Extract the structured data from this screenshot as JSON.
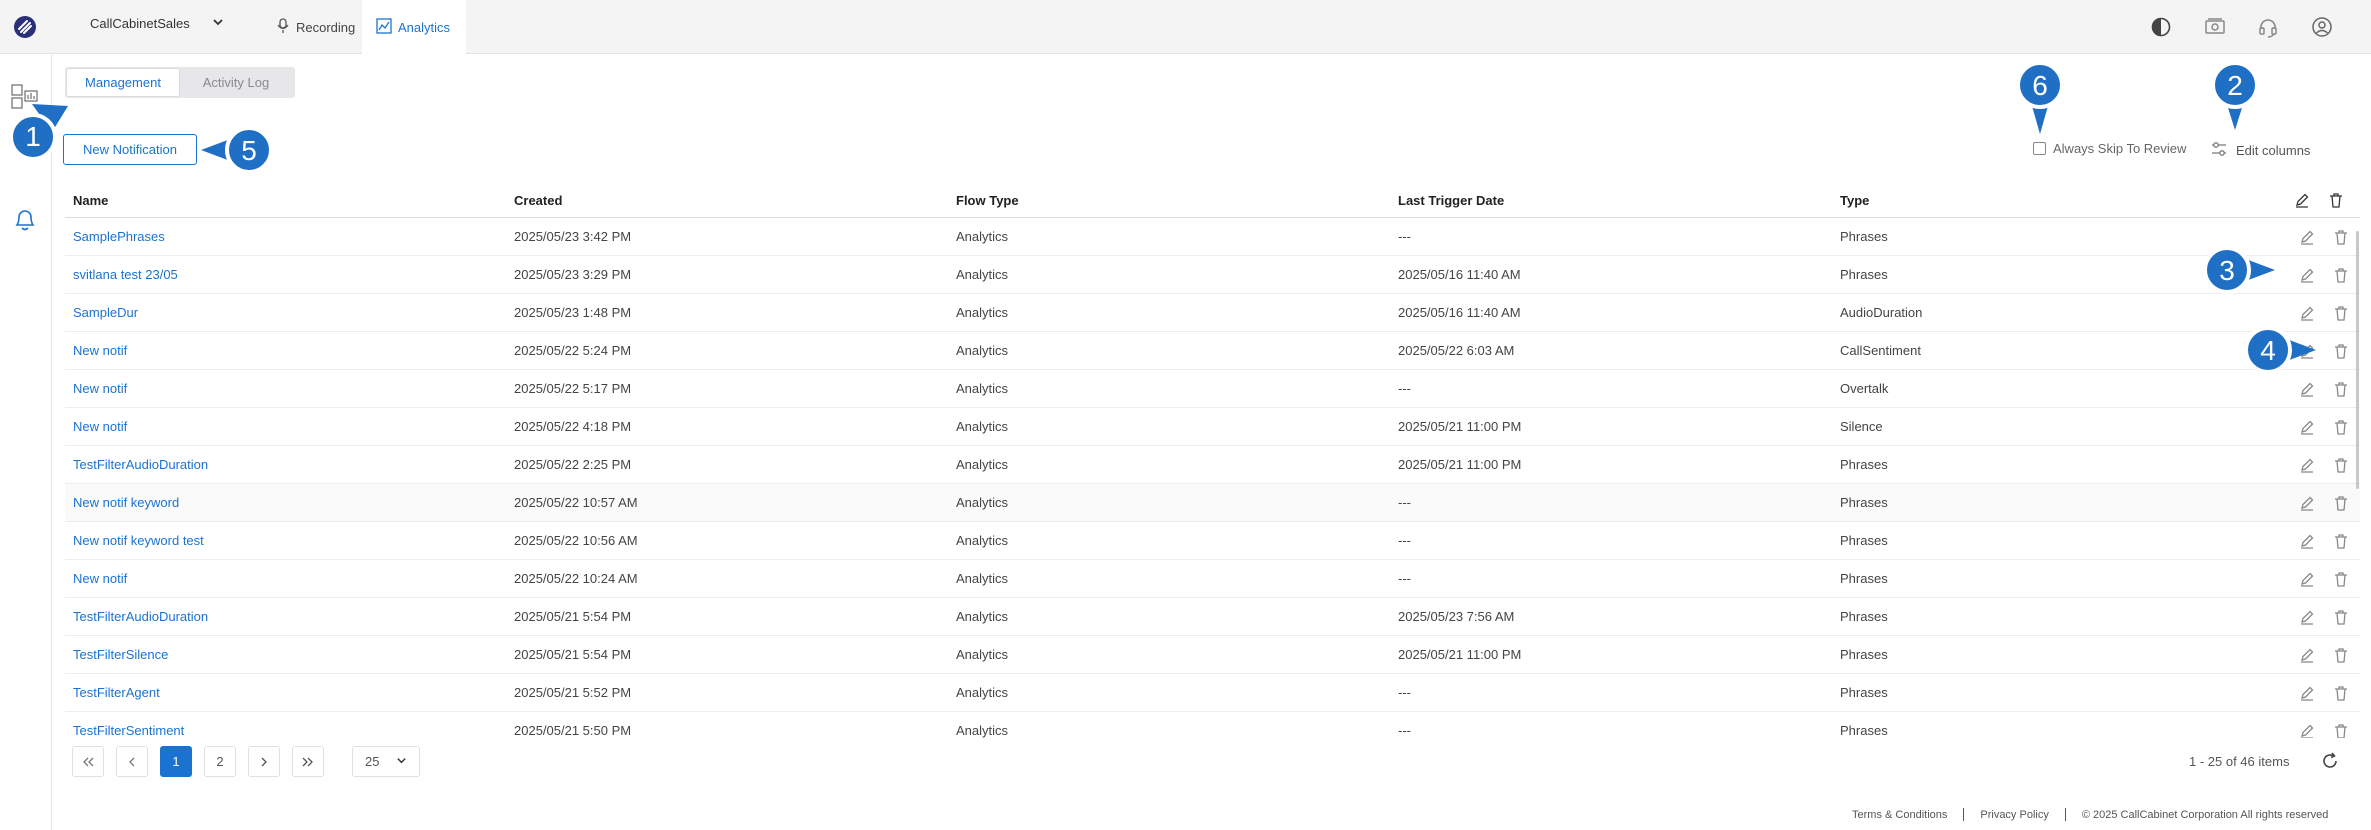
{
  "header": {
    "workspace": "CallCabinetSales",
    "nav": [
      {
        "label": "Recording",
        "icon": "microphone-icon"
      },
      {
        "label": "Analytics",
        "icon": "chart-icon",
        "active": true
      }
    ],
    "right_icons": [
      "contrast-icon",
      "cash-icon",
      "headset-icon",
      "user-icon"
    ]
  },
  "sidebar": {
    "items": [
      {
        "icon": "dashboard-icon"
      },
      {
        "icon": "bell-icon",
        "active": true
      }
    ]
  },
  "tabs": [
    {
      "label": "Management",
      "active": true
    },
    {
      "label": "Activity Log",
      "active": false
    }
  ],
  "toolbar": {
    "new_label": "New Notification",
    "skip_label": "Always Skip To Review",
    "edit_columns_label": "Edit columns"
  },
  "table": {
    "columns": [
      "Name",
      "Created",
      "Flow Type",
      "Last Trigger Date",
      "Type"
    ],
    "rows": [
      {
        "name": "SamplePhrases",
        "created": "2025/05/23 3:42 PM",
        "flow": "Analytics",
        "last": "---",
        "type": "Phrases"
      },
      {
        "name": "svitlana test 23/05",
        "created": "2025/05/23 3:29 PM",
        "flow": "Analytics",
        "last": "2025/05/16 11:40 AM",
        "type": "Phrases"
      },
      {
        "name": "SampleDur",
        "created": "2025/05/23 1:48 PM",
        "flow": "Analytics",
        "last": "2025/05/16 11:40 AM",
        "type": "AudioDuration"
      },
      {
        "name": "New notif",
        "created": "2025/05/22 5:24 PM",
        "flow": "Analytics",
        "last": "2025/05/22 6:03 AM",
        "type": "CallSentiment"
      },
      {
        "name": "New notif",
        "created": "2025/05/22 5:17 PM",
        "flow": "Analytics",
        "last": "---",
        "type": "Overtalk"
      },
      {
        "name": "New notif",
        "created": "2025/05/22 4:18 PM",
        "flow": "Analytics",
        "last": "2025/05/21 11:00 PM",
        "type": "Silence"
      },
      {
        "name": "TestFilterAudioDuration",
        "created": "2025/05/22 2:25 PM",
        "flow": "Analytics",
        "last": "2025/05/21 11:00 PM",
        "type": "Phrases"
      },
      {
        "name": "New notif keyword",
        "created": "2025/05/22 10:57 AM",
        "flow": "Analytics",
        "last": "---",
        "type": "Phrases"
      },
      {
        "name": "New notif keyword test",
        "created": "2025/05/22 10:56 AM",
        "flow": "Analytics",
        "last": "---",
        "type": "Phrases"
      },
      {
        "name": "New notif",
        "created": "2025/05/22 10:24 AM",
        "flow": "Analytics",
        "last": "---",
        "type": "Phrases"
      },
      {
        "name": "TestFilterAudioDuration",
        "created": "2025/05/21 5:54 PM",
        "flow": "Analytics",
        "last": "2025/05/23 7:56 AM",
        "type": "Phrases"
      },
      {
        "name": "TestFilterSilence",
        "created": "2025/05/21 5:54 PM",
        "flow": "Analytics",
        "last": "2025/05/21 11:00 PM",
        "type": "Phrases"
      },
      {
        "name": "TestFilterAgent",
        "created": "2025/05/21 5:52 PM",
        "flow": "Analytics",
        "last": "---",
        "type": "Phrases"
      },
      {
        "name": "TestFilterSentiment",
        "created": "2025/05/21 5:50 PM",
        "flow": "Analytics",
        "last": "---",
        "type": "Phrases"
      }
    ]
  },
  "pagination": {
    "pages": [
      "1",
      "2"
    ],
    "current": "1",
    "page_size": "25",
    "info": "1 - 25 of 46 items"
  },
  "footer": {
    "terms": "Terms & Conditions",
    "privacy": "Privacy Policy",
    "copyright": "© 2025 CallCabinet Corporation All rights reserved"
  },
  "callouts": [
    "1",
    "2",
    "3",
    "4",
    "5",
    "6"
  ],
  "colors": {
    "accent": "#1b73d1",
    "callout": "#1f6fc5"
  }
}
